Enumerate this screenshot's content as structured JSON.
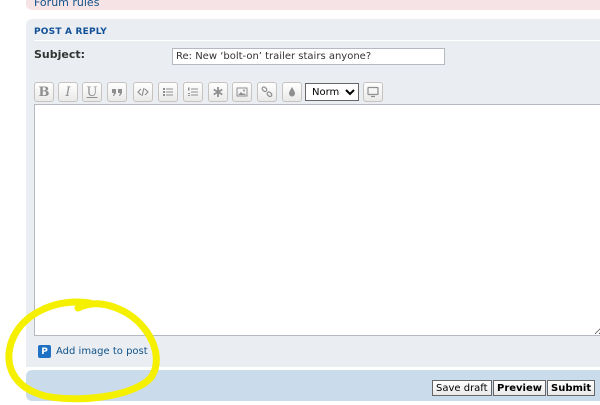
{
  "forum_rules": "Forum rules",
  "panel": {
    "title": "POST A REPLY",
    "subject_label": "Subject:",
    "subject_value": "Re: New ‘bolt-on’ trailer stairs anyone?"
  },
  "toolbar": {
    "bold": "B",
    "italic": "I",
    "underline": "U",
    "size_selected": "Normal",
    "size_options": [
      "Normal"
    ]
  },
  "attach_label": "Add image to post",
  "buttons": {
    "save_draft": "Save draft",
    "preview": "Preview",
    "submit": "Submit"
  },
  "colors": {
    "panel_bg": "#eaeef2",
    "footer_bg": "#cadceb",
    "link": "#105289",
    "highlight": "#f5ef00"
  }
}
